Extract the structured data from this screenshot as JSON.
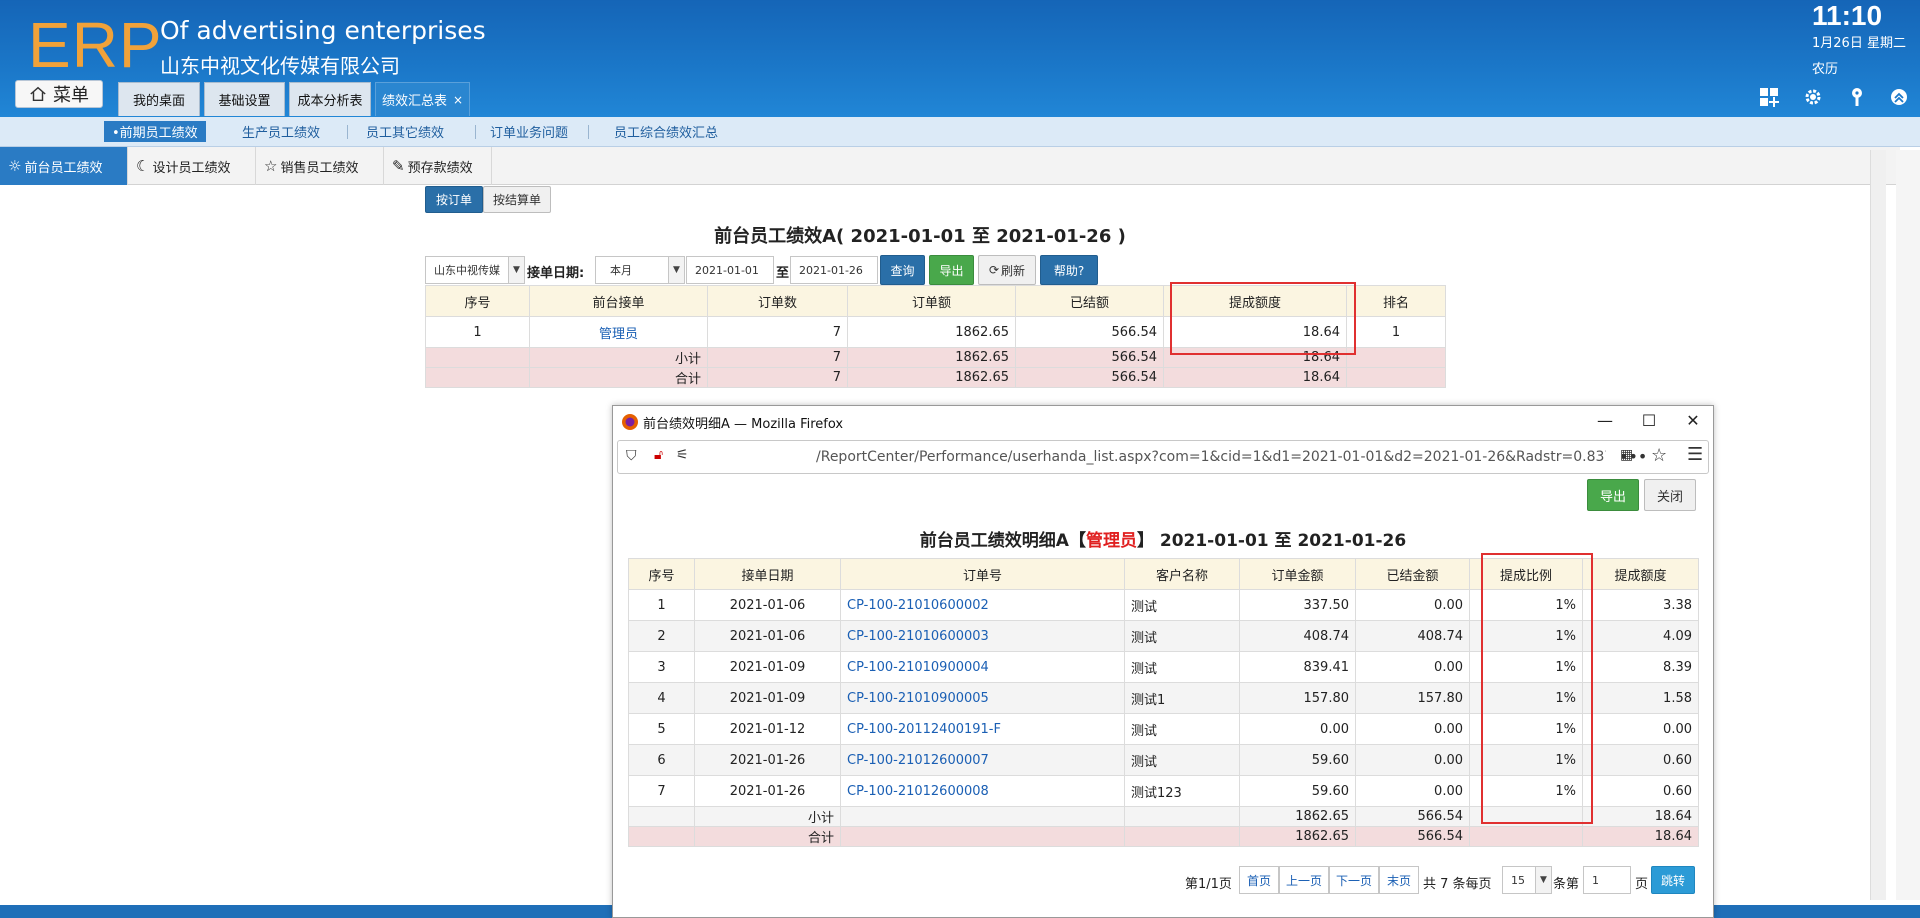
{
  "header": {
    "logo": "ERP",
    "title": "Of advertising enterprises",
    "subtitle": "山东中视文化传媒有限公司",
    "clock": "11:10",
    "date": "1月26日 星期二",
    "lunar": "农历",
    "menu_label": "菜单",
    "tabs": [
      {
        "label": "我的桌面"
      },
      {
        "label": "基础设置"
      },
      {
        "label": "成本分析表"
      },
      {
        "label": "绩效汇总表",
        "close": "×"
      }
    ],
    "icons": [
      "apps-icon",
      "gear-icon",
      "key-icon",
      "collapse-icon"
    ]
  },
  "subnav": {
    "items": [
      {
        "label": "•前期员工绩效"
      },
      {
        "label": "生产员工绩效"
      },
      {
        "label": "员工其它绩效"
      },
      {
        "label": "订单业务问题"
      },
      {
        "label": "员工综合绩效汇总"
      }
    ]
  },
  "categories": [
    {
      "label": "前台员工绩效",
      "icon": "sun-icon"
    },
    {
      "label": "设计员工绩效",
      "icon": "moon-icon"
    },
    {
      "label": "销售员工绩效",
      "icon": "star-icon"
    },
    {
      "label": "预存款绩效",
      "icon": "pencil-icon"
    }
  ],
  "mode_buttons": {
    "by_order": "按订单",
    "by_settle": "按结算单"
  },
  "report": {
    "title": "前台员工绩效A( 2021-01-01 至 2021-01-26 )",
    "company_select": "山东中视传媒",
    "date_label": "接单日期:",
    "period_select": "本月",
    "date_from": "2021-01-01",
    "to_label": "至",
    "date_to": "2021-01-26",
    "query_btn": "查询",
    "export_btn": "导出",
    "refresh_btn": "刷新",
    "help_btn": "帮助?",
    "columns": [
      "序号",
      "前台接单",
      "订单数",
      "订单额",
      "已结额",
      "提成额度",
      "排名"
    ],
    "rows": [
      {
        "no": "1",
        "name": "管理员",
        "orders": "7",
        "amount": "1862.65",
        "settled": "566.54",
        "commission": "18.64",
        "rank": "1"
      }
    ],
    "subtotal": {
      "label": "小计",
      "orders": "7",
      "amount": "1862.65",
      "settled": "566.54",
      "commission": "18.64"
    },
    "total": {
      "label": "合计",
      "orders": "7",
      "amount": "1862.65",
      "settled": "566.54",
      "commission": "18.64"
    }
  },
  "popup": {
    "window_title": "前台绩效明细A — Mozilla Firefox",
    "url": "/ReportCenter/Performance/userhanda_list.aspx?com=1&cid=1&d1=2021-01-01&d2=2021-01-26&Radstr=0.83767",
    "export_btn": "导出",
    "close_btn": "关闭",
    "title_prefix": "前台员工绩效明细A【",
    "title_user": "管理员",
    "title_suffix": "】 2021-01-01 至 2021-01-26",
    "columns": [
      "序号",
      "接单日期",
      "订单号",
      "客户名称",
      "订单金额",
      "已结金额",
      "提成比例",
      "提成额度"
    ],
    "rows": [
      {
        "no": "1",
        "date": "2021-01-06",
        "order": "CP-100-21010600002",
        "customer": "测试",
        "amount": "337.50",
        "settled": "0.00",
        "rate": "1%",
        "commission": "3.38"
      },
      {
        "no": "2",
        "date": "2021-01-06",
        "order": "CP-100-21010600003",
        "customer": "测试",
        "amount": "408.74",
        "settled": "408.74",
        "rate": "1%",
        "commission": "4.09"
      },
      {
        "no": "3",
        "date": "2021-01-09",
        "order": "CP-100-21010900004",
        "customer": "测试",
        "amount": "839.41",
        "settled": "0.00",
        "rate": "1%",
        "commission": "8.39"
      },
      {
        "no": "4",
        "date": "2021-01-09",
        "order": "CP-100-21010900005",
        "customer": "测试1",
        "amount": "157.80",
        "settled": "157.80",
        "rate": "1%",
        "commission": "1.58"
      },
      {
        "no": "5",
        "date": "2021-01-12",
        "order": "CP-100-20112400191-F",
        "customer": "测试",
        "amount": "0.00",
        "settled": "0.00",
        "rate": "1%",
        "commission": "0.00"
      },
      {
        "no": "6",
        "date": "2021-01-26",
        "order": "CP-100-21012600007",
        "customer": "测试",
        "amount": "59.60",
        "settled": "0.00",
        "rate": "1%",
        "commission": "0.60"
      },
      {
        "no": "7",
        "date": "2021-01-26",
        "order": "CP-100-21012600008",
        "customer": "测试123",
        "amount": "59.60",
        "settled": "0.00",
        "rate": "1%",
        "commission": "0.60"
      }
    ],
    "subtotal": {
      "label": "小计",
      "amount": "1862.65",
      "settled": "566.54",
      "commission": "18.64"
    },
    "total": {
      "label": "合计",
      "amount": "1862.65",
      "settled": "566.54",
      "commission": "18.64"
    },
    "pager": {
      "page_info": "第1/1页",
      "first": "首页",
      "prev": "上一页",
      "next": "下一页",
      "last": "末页",
      "count_text": "共 7 条每页",
      "page_size": "15",
      "items_label": "条第",
      "page_input": "1",
      "page_label": "页",
      "go": "跳转"
    }
  },
  "colors": {
    "accent": "#2a7bc4",
    "highlight_box": "#e03030",
    "logo": "#f0a23a"
  }
}
